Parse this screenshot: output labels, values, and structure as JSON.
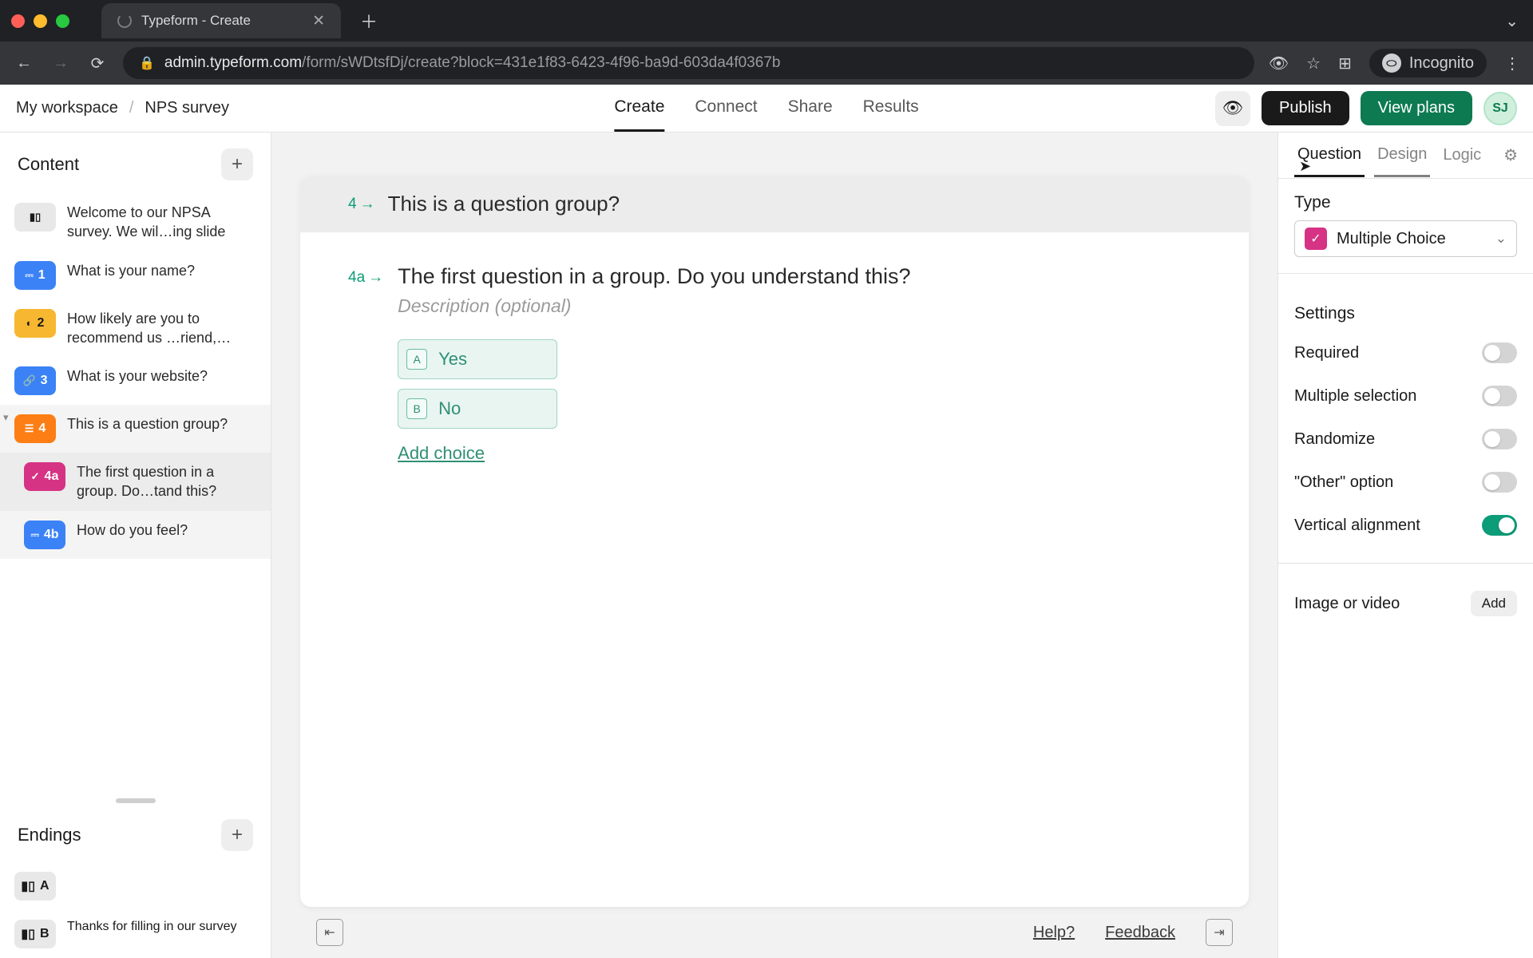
{
  "browser": {
    "tab_title": "Typeform - Create",
    "url_host": "admin.typeform.com",
    "url_path": "/form/sWDtsfDj/create?block=431e1f83-6423-4f96-ba9d-603da4f0367b",
    "incognito_label": "Incognito"
  },
  "header": {
    "workspace": "My workspace",
    "form_title": "NPS survey",
    "tabs": {
      "create": "Create",
      "connect": "Connect",
      "share": "Share",
      "results": "Results"
    },
    "publish": "Publish",
    "view_plans": "View plans",
    "avatar_initials": "SJ"
  },
  "sidebar": {
    "content_label": "Content",
    "items": [
      {
        "num": "",
        "label": "Welcome to our NPSA survey. We wil…ing slide"
      },
      {
        "num": "1",
        "label": "What is your name?"
      },
      {
        "num": "2",
        "label": "How likely are you to recommend us …riend,…"
      },
      {
        "num": "3",
        "label": "What is your website?"
      },
      {
        "num": "4",
        "label": "This is a question group?"
      },
      {
        "num": "4a",
        "label": "The first question in a group. Do…tand this?"
      },
      {
        "num": "4b",
        "label": "How do you feel?"
      }
    ],
    "endings_label": "Endings",
    "endings": [
      {
        "key": "A",
        "label": ""
      },
      {
        "key": "B",
        "label": "Thanks for filling in our survey"
      }
    ]
  },
  "canvas": {
    "group_num": "4",
    "group_title": "This is a question group?",
    "q_num": "4a",
    "q_title": "The first question in a group. Do you understand this?",
    "q_desc_placeholder": "Description (optional)",
    "choices": [
      {
        "key": "A",
        "label": "Yes"
      },
      {
        "key": "B",
        "label": "No"
      }
    ],
    "add_choice": "Add choice",
    "footer": {
      "help": "Help?",
      "feedback": "Feedback"
    }
  },
  "right": {
    "tabs": {
      "question": "Question",
      "design": "Design",
      "logic": "Logic"
    },
    "type_label": "Type",
    "type_value": "Multiple Choice",
    "settings_label": "Settings",
    "settings": {
      "required": "Required",
      "multiple": "Multiple selection",
      "randomize": "Randomize",
      "other": "\"Other\" option",
      "vertical": "Vertical alignment"
    },
    "image_label": "Image or video",
    "add_btn": "Add"
  }
}
